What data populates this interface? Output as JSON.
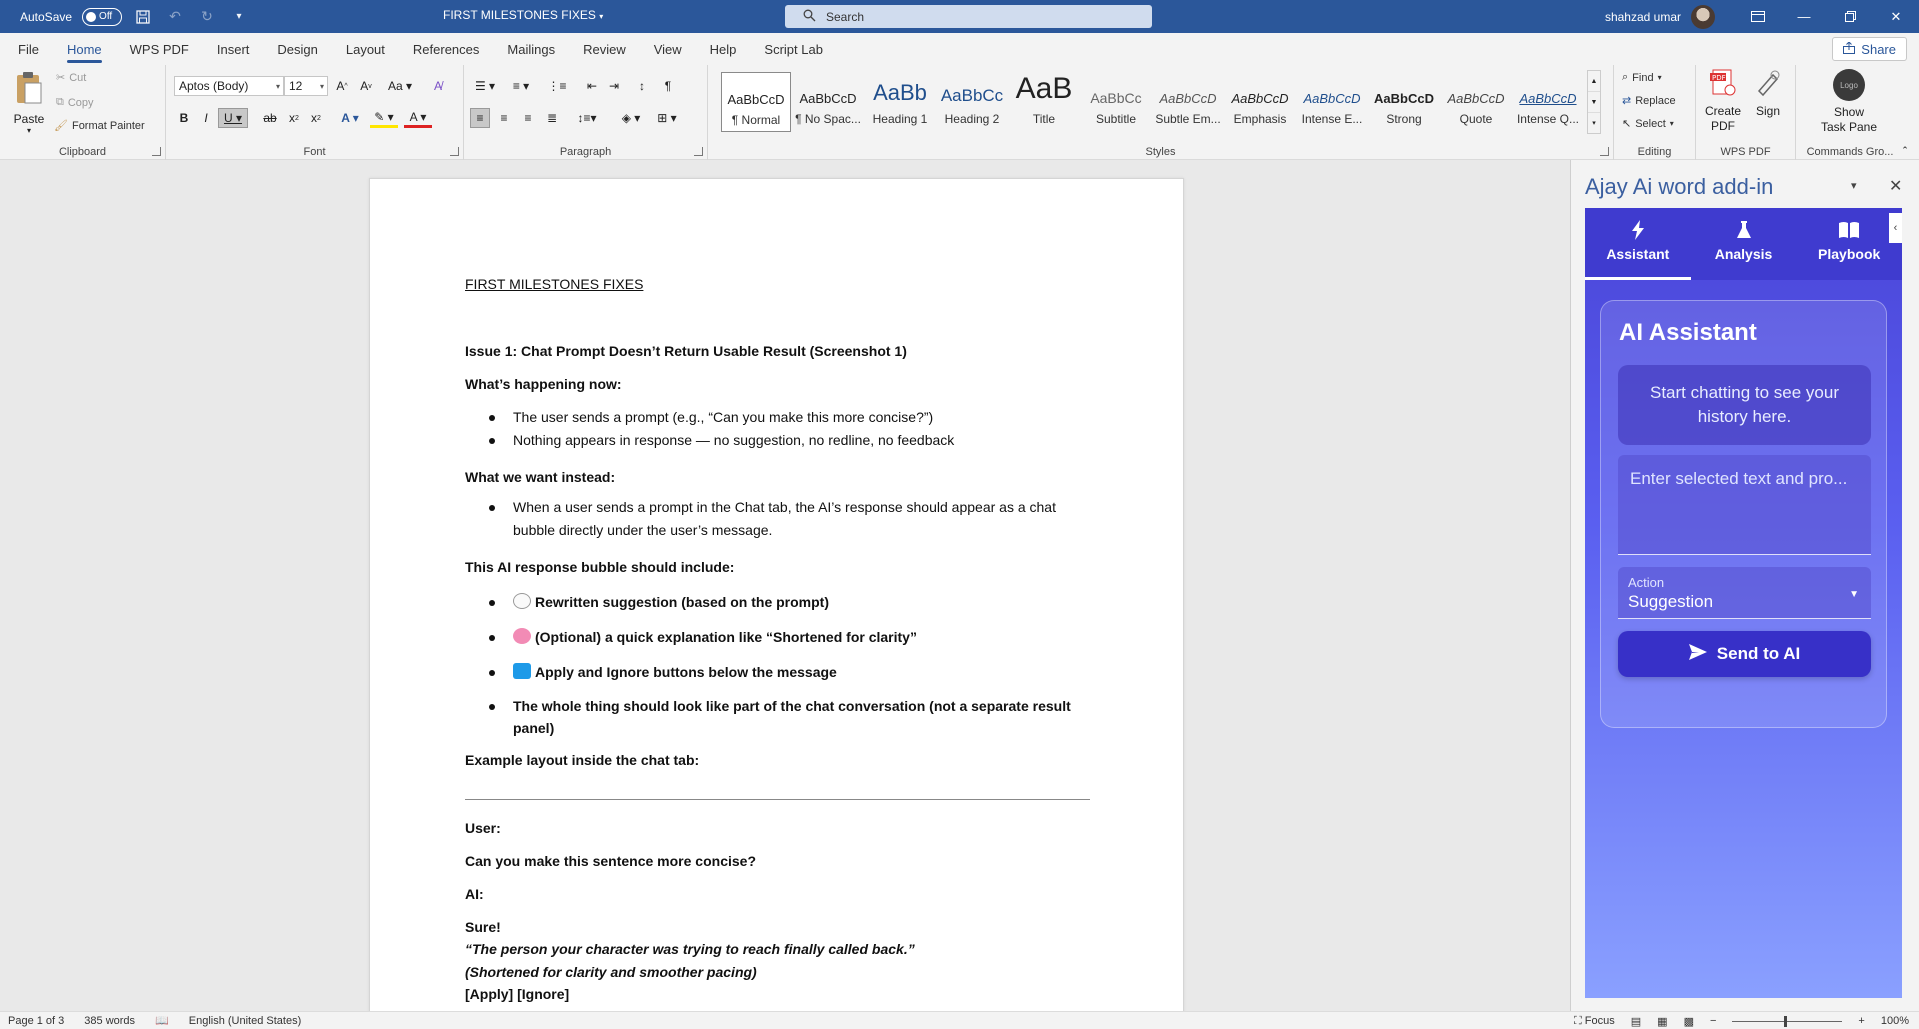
{
  "titlebar": {
    "autosave_label": "AutoSave",
    "autosave_state": "Off",
    "doc_title": "FIRST MILESTONES FIXES",
    "search_placeholder": "Search",
    "user_name": "shahzad umar"
  },
  "tabs": [
    "File",
    "Home",
    "WPS PDF",
    "Insert",
    "Design",
    "Layout",
    "References",
    "Mailings",
    "Review",
    "View",
    "Help",
    "Script Lab"
  ],
  "active_tab": "Home",
  "share_label": "Share",
  "ribbon": {
    "clipboard": {
      "paste": "Paste",
      "cut": "Cut",
      "copy": "Copy",
      "format_painter": "Format Painter",
      "label": "Clipboard"
    },
    "font": {
      "name": "Aptos (Body)",
      "size": "12",
      "label": "Font"
    },
    "paragraph": {
      "label": "Paragraph"
    },
    "styles": {
      "label": "Styles",
      "items": [
        {
          "sample": "AaBbCcD",
          "name": "¶ Normal"
        },
        {
          "sample": "AaBbCcD",
          "name": "¶ No Spac..."
        },
        {
          "sample": "AaBb",
          "name": "Heading 1"
        },
        {
          "sample": "AaBbCc",
          "name": "Heading 2"
        },
        {
          "sample": "AaB",
          "name": "Title"
        },
        {
          "sample": "AaBbCc",
          "name": "Subtitle"
        },
        {
          "sample": "AaBbCcD",
          "name": "Subtle Em..."
        },
        {
          "sample": "AaBbCcD",
          "name": "Emphasis"
        },
        {
          "sample": "AaBbCcD",
          "name": "Intense E..."
        },
        {
          "sample": "AaBbCcD",
          "name": "Strong"
        },
        {
          "sample": "AaBbCcD",
          "name": "Quote"
        },
        {
          "sample": "AaBbCcD",
          "name": "Intense Q..."
        }
      ]
    },
    "editing": {
      "find": "Find",
      "replace": "Replace",
      "select": "Select",
      "label": "Editing"
    },
    "wps_pdf": {
      "create_pdf_1": "Create",
      "create_pdf_2": "PDF",
      "sign": "Sign",
      "label": "WPS PDF"
    },
    "commands": {
      "logo_text": "Logo",
      "show_1": "Show",
      "show_2": "Task Pane",
      "label": "Commands Gro..."
    }
  },
  "document": {
    "heading": "FIRST MILESTONES FIXES",
    "issue_title": "Issue 1: Chat Prompt Doesn’t Return Usable Result (Screenshot 1)",
    "whats_happening": "What’s happening now:",
    "happening_bullets": [
      "The user sends a prompt (e.g., “Can you make this more concise?”)",
      "Nothing appears in response — no suggestion, no redline, no feedback"
    ],
    "what_we_want": "What we want instead:",
    "want_bullet_1": "When a user sends a prompt in the Chat tab, the AI’s response should appear as a chat",
    "want_bullet_2": "bubble directly under the user’s message.",
    "bubble_include": "This AI response bubble should include:",
    "include_bullets": [
      "Rewritten suggestion (based on the prompt)",
      "(Optional) a quick explanation like “Shortened for clarity”",
      "Apply and Ignore buttons below the message"
    ],
    "whole_thing_1": "The whole thing should look like part of the chat conversation (not a separate result",
    "whole_thing_2": "panel)",
    "example_layout": "Example layout inside the chat tab:",
    "user_label": "User:",
    "user_msg": "Can you make this sentence more concise?",
    "ai_label": "AI:",
    "sure": "Sure!",
    "quote": "“The person your character was trying to reach finally called back.”",
    "shortened": "(Shortened for clarity and smoother pacing)",
    "buttons": "[Apply] [Ignore]"
  },
  "pane": {
    "title": "Ajay Ai word add-in",
    "nav": [
      "Assistant",
      "Analysis",
      "Playbook"
    ],
    "active_nav": "Assistant",
    "card_title": "AI Assistant",
    "history_text": "Start chatting to see your history here.",
    "prompt_placeholder": "Enter selected text and pro...",
    "action_label": "Action",
    "action_value": "Suggestion",
    "send_label": "Send to AI"
  },
  "status": {
    "page": "Page 1 of 3",
    "words": "385 words",
    "language": "English (United States)",
    "focus": "Focus",
    "zoom": "100%"
  },
  "colors": {
    "word_blue": "#2b579a",
    "addin_purple": "#4a45d8"
  }
}
